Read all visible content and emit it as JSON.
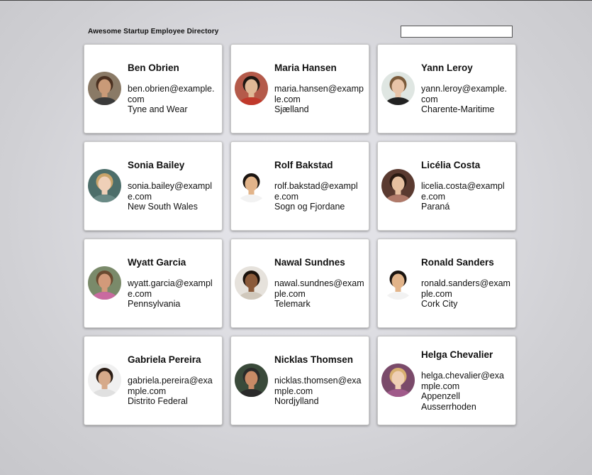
{
  "header": {
    "title": "Awesome Startup Employee Directory",
    "search_value": ""
  },
  "employees": [
    {
      "name": "Ben Obrien",
      "email": "ben.obrien@example.com",
      "location": "Tyne and Wear",
      "skin": "#c99a78",
      "hair": "#4a3020",
      "bg": "#8a7a66",
      "shirt": "#3a3a3a"
    },
    {
      "name": "Maria Hansen",
      "email": "maria.hansen@example.com",
      "location": "Sjælland",
      "skin": "#e0b896",
      "hair": "#1e1612",
      "bg": "#b45a4a",
      "shirt": "#c0392b"
    },
    {
      "name": "Yann Leroy",
      "email": "yann.leroy@example.com",
      "location": "Charente-Maritime",
      "skin": "#e8c4a8",
      "hair": "#7a5a3a",
      "bg": "#dfe6e2",
      "shirt": "#222222"
    },
    {
      "name": "Sonia Bailey",
      "email": "sonia.bailey@example.com",
      "location": "New South Wales",
      "skin": "#efd0b8",
      "hair": "#c9a46a",
      "bg": "#4d6e6a",
      "shirt": "#6a8a86"
    },
    {
      "name": "Rolf Bakstad",
      "email": "rolf.bakstad@example.com",
      "location": "Sogn og Fjordane",
      "skin": "#e2b48a",
      "hair": "#1a1410",
      "bg": "#ffffff",
      "shirt": "#f2f2f2"
    },
    {
      "name": "Licélia Costa",
      "email": "licelia.costa@example.com",
      "location": "Paraná",
      "skin": "#e6c0a0",
      "hair": "#2a1a12",
      "bg": "#5a3a30",
      "shirt": "#b07a6a"
    },
    {
      "name": "Wyatt Garcia",
      "email": "wyatt.garcia@example.com",
      "location": "Pennsylvania",
      "skin": "#d29a7a",
      "hair": "#6a4a30",
      "bg": "#7a8a6a",
      "shirt": "#c96aa0"
    },
    {
      "name": "Nawal Sundnes",
      "email": "nawal.sundnes@example.com",
      "location": "Telemark",
      "skin": "#8a5a3a",
      "hair": "#1a120c",
      "bg": "#e6e2dc",
      "shirt": "#d0c8bc"
    },
    {
      "name": "Ronald Sanders",
      "email": "ronald.sanders@example.com",
      "location": "Cork City",
      "skin": "#e2b48a",
      "hair": "#1a1410",
      "bg": "#ffffff",
      "shirt": "#f2f2f2"
    },
    {
      "name": "Gabriela Pereira",
      "email": "gabriela.pereira@example.com",
      "location": "Distrito Federal",
      "skin": "#d6aa8a",
      "hair": "#2a1c14",
      "bg": "#f0f0f0",
      "shirt": "#e0e0e0"
    },
    {
      "name": "Nicklas Thomsen",
      "email": "nicklas.thomsen@example.com",
      "location": "Nordjylland",
      "skin": "#c98a66",
      "hair": "#2a2a2a",
      "bg": "#3a4a3a",
      "shirt": "#2a2a2a"
    },
    {
      "name": "Helga Chevalier",
      "email": "helga.chevalier@example.com",
      "location": "Appenzell Ausserrhoden",
      "skin": "#efcfb4",
      "hair": "#d8b070",
      "bg": "#7a4a6a",
      "shirt": "#a05a8a"
    }
  ]
}
